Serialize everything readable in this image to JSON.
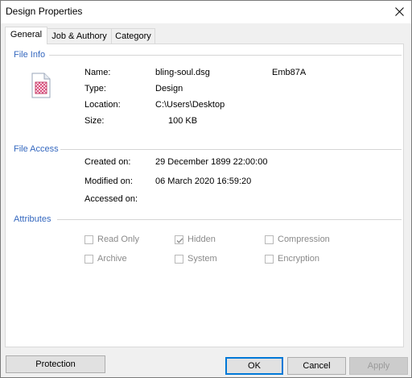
{
  "window": {
    "title": "Design Properties"
  },
  "tabs": [
    {
      "label": "General"
    },
    {
      "label": "Job & Authory"
    },
    {
      "label": "Category"
    }
  ],
  "file_info": {
    "group_label": "File Info",
    "name_label": "Name:",
    "name_value": "bling-soul.dsg",
    "name_extra": "Emb87A",
    "type_label": "Type:",
    "type_value": "Design",
    "location_label": "Location:",
    "location_value": "C:\\Users\\Desktop",
    "size_label": "Size:",
    "size_value": "100 KB",
    "icon": "file-icon"
  },
  "file_access": {
    "group_label": "File Access",
    "created_label": "Created on:",
    "created_value": "29 December 1899 22:00:00",
    "modified_label": "Modified on:",
    "modified_value": "06 March 2020 16:59:20",
    "accessed_label": "Accessed on:"
  },
  "attributes": {
    "group_label": "Attributes",
    "items": [
      {
        "label": "Read Only",
        "checked": false
      },
      {
        "label": "Hidden",
        "checked": true
      },
      {
        "label": "Compression",
        "checked": false
      },
      {
        "label": "Archive",
        "checked": false
      },
      {
        "label": "System",
        "checked": false
      },
      {
        "label": "Encryption",
        "checked": false
      }
    ]
  },
  "buttons": {
    "protection": "Protection",
    "ok": "OK",
    "cancel": "Cancel",
    "apply": "Apply"
  },
  "colors": {
    "group_label": "#3568bf",
    "accent": "#0078d7"
  }
}
